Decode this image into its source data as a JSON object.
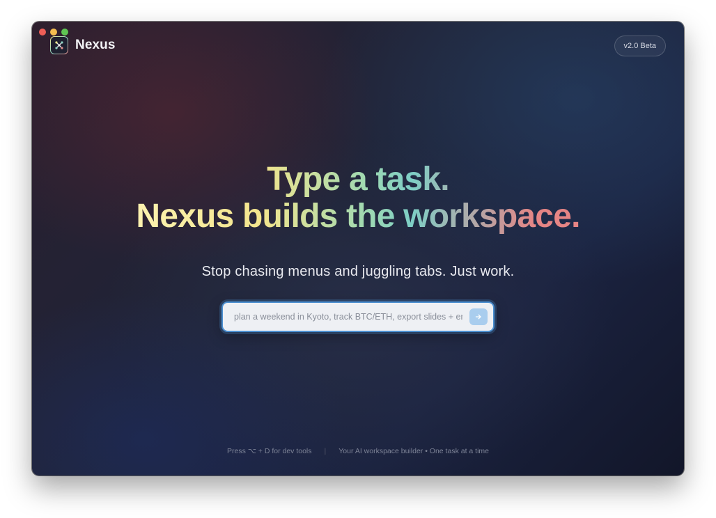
{
  "app": {
    "name": "Nexus",
    "logo_icon": "nexus-logo-icon",
    "version_badge": "v2.0 Beta"
  },
  "colors": {
    "accent_blue": "#4b8fd0",
    "headline_gradient": [
      "#fdf3b0",
      "#f4e58d",
      "#9fd9b2",
      "#7ecfc6",
      "#b1a8a8",
      "#e68585"
    ]
  },
  "hero": {
    "headline_line1": "Type a task.",
    "headline_line2": "Nexus builds the workspace.",
    "subtitle": "Stop chasing menus and juggling tabs. Just work."
  },
  "search": {
    "placeholder": "plan a weekend in Kyoto, track BTC/ETH, export slides + email",
    "value": "",
    "submit_icon": "arrow-right-icon"
  },
  "footer": {
    "left": "Press ⌥ + D for dev tools",
    "separator": "|",
    "right": "Your AI workspace builder • One task at a time"
  }
}
